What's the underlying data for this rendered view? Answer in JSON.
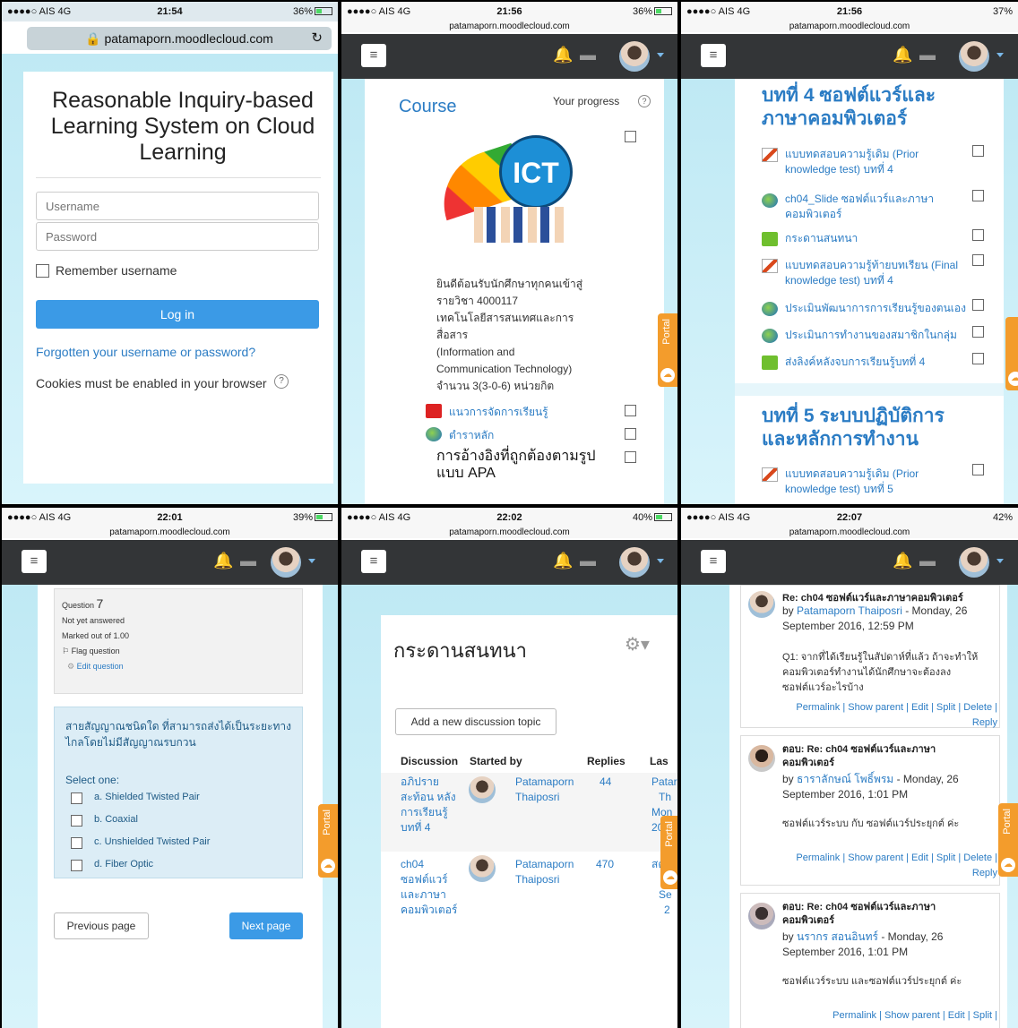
{
  "p1": {
    "status": {
      "carrier": "●●●●○ AIS  4G",
      "time": "21:54",
      "battery": "36%"
    },
    "url": "patamaporn.moodlecloud.com",
    "title": "Reasonable Inquiry-based Learning System on Cloud Learning",
    "username_placeholder": "Username",
    "password_placeholder": "Password",
    "remember": "Remember username",
    "login": "Log in",
    "forgot": "Forgotten your username or password?",
    "cookies": "Cookies must be enabled in your browser"
  },
  "p2": {
    "status": {
      "carrier": "●●●●○ AIS  4G",
      "time": "21:56",
      "battery": "36%"
    },
    "url": "patamaporn.moodlecloud.com",
    "course": "Course",
    "progress": "Your progress",
    "logo": "ICT",
    "intro": [
      "ยินดีต้อนรับนักศึกษาทุกคนเข้าสู่",
      "รายวิชา 4000117",
      "เทคโนโลยีสารสนเทศและการ",
      "สื่อสาร",
      "(Information and",
      "Communication Technology)",
      "จำนวน 3(3-0-6) หน่วยกิต"
    ],
    "act1": "แนวการจัดการเรียนรู้",
    "act2": "ตำราหลัก",
    "act3": "การอ้างอิงที่ถูกต้องตามรูปแบบ APA",
    "portal": "Portal"
  },
  "p3": {
    "status": {
      "carrier": "●●●●○ AIS  4G",
      "time": "21:56",
      "battery": "37%"
    },
    "url": "patamaporn.moodlecloud.com",
    "sec4": "บทที่ 4 ซอฟต์แวร์และภาษาคอมพิวเตอร์",
    "items": [
      "แบบทดสอบความรู้เดิม (Prior knowledge test) บทที่ 4",
      "ch04_Slide ซอฟต์แวร์และภาษาคอมพิวเตอร์",
      "กระดานสนทนา",
      "แบบทดสอบความรู้ท้ายบทเรียน (Final knowledge test) บทที่ 4",
      "ประเมินพัฒนาการการเรียนรู้ของตนเอง",
      "ประเมินการทำงานของสมาชิกในกลุ่ม",
      "ส่งลิงค์หลังจบการเรียนรู้บทที่ 4"
    ],
    "sec5": "บทที่ 5 ระบบปฏิบัติการและหลักการทำงาน",
    "item5": "แบบทดสอบความรู้เดิม (Prior knowledge test) บทที่ 5"
  },
  "p4": {
    "status": {
      "carrier": "●●●●○ AIS  4G",
      "time": "22:01",
      "battery": "39%"
    },
    "url": "patamaporn.moodlecloud.com",
    "qlabel": "Question",
    "qnum": "7",
    "state": "Not yet answered",
    "marked": "Marked out of 1.00",
    "flag": "Flag question",
    "edit": "Edit question",
    "qtext": "สายสัญญาณชนิดใด ที่สามารถส่งได้เป็นระยะทางไกลโดยไม่มีสัญญาณรบกวน",
    "select": "Select one:",
    "opts": [
      "a. Shielded Twisted Pair",
      "b. Coaxial",
      "c. Unshielded Twisted Pair",
      "d. Fiber Optic"
    ],
    "prev": "Previous page",
    "next": "Next page",
    "portal": "Portal"
  },
  "p5": {
    "status": {
      "carrier": "●●●●○ AIS  4G",
      "time": "22:02",
      "battery": "40%"
    },
    "url": "patamaporn.moodlecloud.com",
    "title": "กระดานสนทนา",
    "add": "Add a new discussion topic",
    "cols": [
      "Discussion",
      "Started by",
      "Replies",
      "Las"
    ],
    "r1": {
      "d": [
        "อภิปราย",
        "สะท้อน หลัง",
        "การเรียนรู้",
        "บทที่ 4"
      ],
      "by": [
        "Patamaporn",
        "Thaiposri"
      ],
      "rep": "44",
      "last": [
        "Patar",
        "Th",
        "Mon",
        "201"
      ]
    },
    "r2": {
      "d": [
        "ch04",
        "ซอฟต์แวร์",
        "และภาษา",
        "คอมพิวเตอร์"
      ],
      "by": [
        "Patamaporn",
        "Thaiposri"
      ],
      "rep": "470",
      "last": [
        "สตรี",
        "M",
        "Se",
        "2"
      ]
    },
    "portal": "Portal"
  },
  "p6": {
    "status": {
      "carrier": "●●●●○ AIS  4G",
      "time": "22:07",
      "battery": "42%"
    },
    "url": "patamaporn.moodlecloud.com",
    "posts": [
      {
        "title": "Re: ch04 ซอฟต์แวร์และภาษาคอมพิวเตอร์",
        "by": "by",
        "author": "Patamaporn Thaiposri",
        "date": "- Monday, 26 September 2016, 12:59 PM",
        "body": "Q1: จากที่ได้เรียนรู้ในสัปดาห์ที่แล้ว ถ้าจะทำให้คอมพิวเตอร์ทำงานได้นักศึกษาจะต้องลงซอฟต์แวร์อะไรบ้าง",
        "links": "Permalink | Show parent | Edit | Split | Delete | Reply"
      },
      {
        "title": "ตอบ: Re: ch04 ซอฟต์แวร์และภาษาคอมพิวเตอร์",
        "by": "by",
        "author": "ธาราลักษณ์ โพธิ์พรม",
        "date": "- Monday, 26 September 2016, 1:01 PM",
        "body": "ซอฟต์แวร์ระบบ กับ ซอฟต์แวร์ประยุกต์ ค่ะ",
        "links": "Permalink | Show parent | Edit | Split | Delete | Reply"
      },
      {
        "title": "ตอบ: Re: ch04 ซอฟต์แวร์และภาษาคอมพิวเตอร์",
        "by": "by",
        "author": "นรากร สอนอินทร์",
        "date": "- Monday, 26 September 2016, 1:01 PM",
        "body": "ซอฟต์แวร์ระบบ และซอฟต์แวร์ประยุกต์ ค่ะ",
        "links": "Permalink | Show parent | Edit | Split |"
      }
    ],
    "portal": "Portal"
  }
}
